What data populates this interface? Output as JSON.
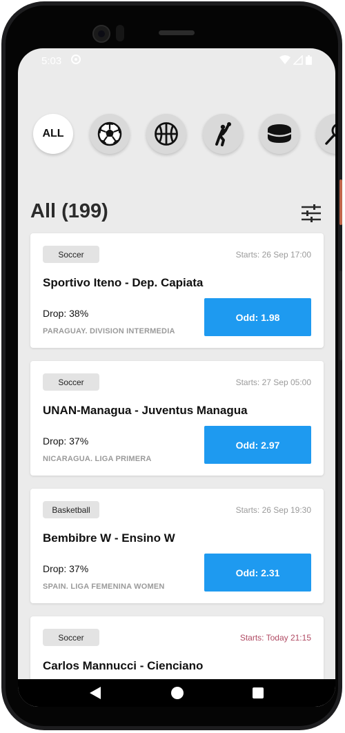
{
  "status_bar": {
    "time": "5:03"
  },
  "categories": {
    "all_label": "ALL",
    "items": [
      "all",
      "soccer",
      "basketball",
      "handball",
      "ice-hockey",
      "tennis"
    ]
  },
  "list": {
    "title": "All (199)"
  },
  "matches": [
    {
      "sport": "Soccer",
      "starts": "Starts: 26 Sep 17:00",
      "title": "Sportivo Iteno - Dep. Capiata",
      "drop": "Drop: 38%",
      "league": "PARAGUAY. DIVISION INTERMEDIA",
      "odd": "Odd: 1.98"
    },
    {
      "sport": "Soccer",
      "starts": "Starts: 27 Sep 05:00",
      "title": "UNAN-Managua - Juventus Managua",
      "drop": "Drop: 37%",
      "league": "NICARAGUA. LIGA PRIMERA",
      "odd": "Odd: 2.97"
    },
    {
      "sport": "Basketball",
      "starts": "Starts: 26 Sep 19:30",
      "title": "Bembibre W - Ensino W",
      "drop": "Drop: 37%",
      "league": "SPAIN. LIGA FEMENINA WOMEN",
      "odd": "Odd: 2.31"
    },
    {
      "sport": "Soccer",
      "starts": "Starts: Today 21:15",
      "title": "Carlos Mannucci - Cienciano"
    }
  ],
  "colors": {
    "accent": "#1e9af0",
    "today": "#b04a63",
    "background": "#ebebeb"
  }
}
